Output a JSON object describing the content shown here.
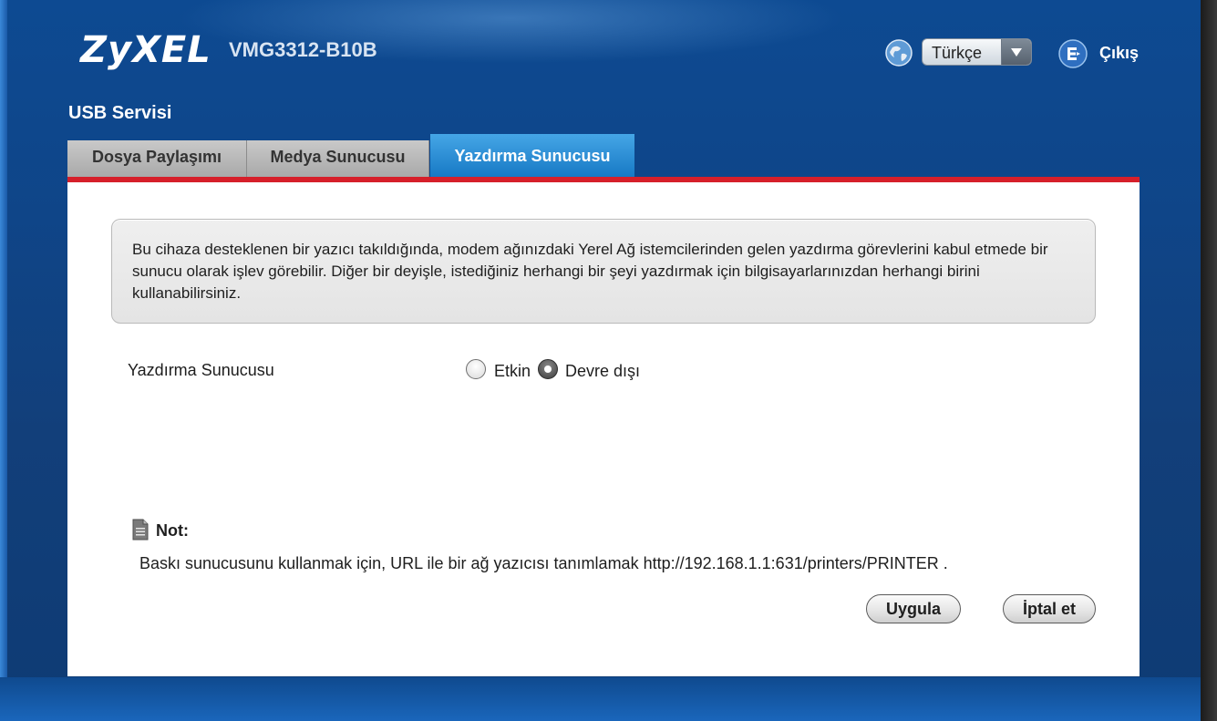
{
  "header": {
    "logo": "ZyXEL",
    "model": "VMG3312-B10B",
    "language": {
      "selected": "Türkçe"
    },
    "logout_label": "Çıkış"
  },
  "page": {
    "title": "USB Servisi"
  },
  "tabs": [
    {
      "label": "Dosya Paylaşımı",
      "active": false
    },
    {
      "label": "Medya Sunucusu",
      "active": false
    },
    {
      "label": "Yazdırma Sunucusu",
      "active": true
    }
  ],
  "info": {
    "text": "Bu cihaza desteklenen bir yazıcı takıldığında, modem ağınızdaki Yerel Ağ istemcilerinden gelen yazdırma görevlerini kabul etmede bir sunucu olarak işlev görebilir. Diğer bir deyişle, istediğiniz herhangi bir şeyi yazdırmak için bilgisayarlarınızdan herhangi birini kullanabilirsiniz."
  },
  "print_server": {
    "label": "Yazdırma Sunucusu",
    "options": [
      {
        "label": "Etkin",
        "checked": false
      },
      {
        "label": "Devre dışı",
        "checked": true
      }
    ]
  },
  "note": {
    "title": "Not:",
    "text": "Baskı sunucusunu kullanmak için, URL ile bir ağ yazıcısı tanımlamak http://192.168.1.1:631/printers/PRINTER ."
  },
  "buttons": {
    "apply": "Uygula",
    "cancel": "İptal et"
  },
  "colors": {
    "accent_red": "#d61f2a",
    "active_tab": "#1678c4",
    "background_blue": "#0f4588"
  }
}
